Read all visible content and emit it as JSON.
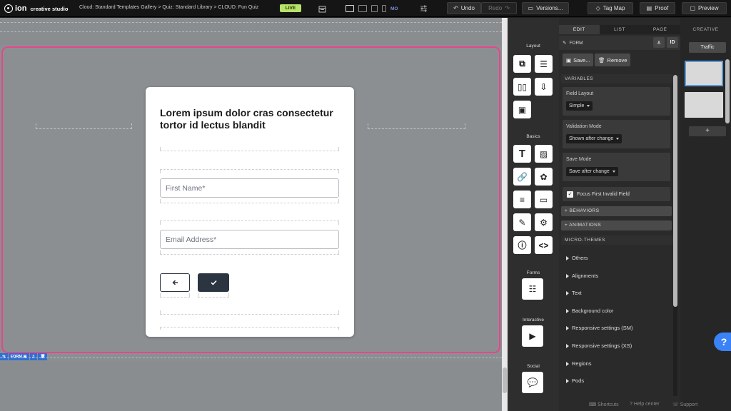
{
  "topbar": {
    "logo_text": "ion",
    "logo_subtitle": "creative studio",
    "breadcrumb": "Cloud: Standard Templates Gallery > Quiz: Standard Library > CLOUD: Fun Quiz",
    "live_badge": "LIVE",
    "device_mode": "MO",
    "undo_label": "Undo",
    "redo_label": "Redo",
    "versions_label": "Versions...",
    "tagmap_label": "Tag Map",
    "proof_label": "Proof",
    "preview_label": "Preview"
  },
  "canvas": {
    "selection_color": "#e5478b",
    "form_tag": "FORM"
  },
  "form": {
    "title": "Lorem ipsum dolor cras consectetur tortor id lectus blandit",
    "first_name_placeholder": "First Name*",
    "email_placeholder": "Email Address*",
    "back_icon": "arrow-left-icon",
    "submit_icon": "check-icon"
  },
  "components": {
    "layout_label": "Layout",
    "basics_label": "Basics",
    "forms_label": "Forms",
    "interactive_label": "Interactive",
    "social_label": "Social"
  },
  "props": {
    "tabs": [
      "EDIT",
      "LIST",
      "PAGE"
    ],
    "header_label": "FORM",
    "id_label": "ID",
    "save_label": "Save...",
    "remove_label": "Remove",
    "variables_label": "VARIABLES",
    "field_layout_label": "Field Layout",
    "field_layout_value": "Simple",
    "validation_label": "Validation Mode",
    "validation_value": "Shown after change",
    "save_mode_label": "Save Mode",
    "save_mode_value": "Save after change",
    "focus_label": "Focus First Invalid Field",
    "behaviors_label": "+ BEHAVIORS",
    "animations_label": "+ ANIMATIONS",
    "micro_themes_label": "MICRO-THEMES",
    "micro_items": [
      "Others",
      "Alignments",
      "Text",
      "Background color",
      "Responsive settings (SM)",
      "Responsive settings (XS)",
      "Regions",
      "Pods"
    ],
    "shortcuts_label": "Shortcuts",
    "help_label": "Help center",
    "support_label": "Support"
  },
  "creative": {
    "tab_label": "CREATIVE",
    "traffic_label": "Traffic",
    "add_label": "+",
    "help_bubble": "?",
    "accent": "#3b82f6"
  }
}
